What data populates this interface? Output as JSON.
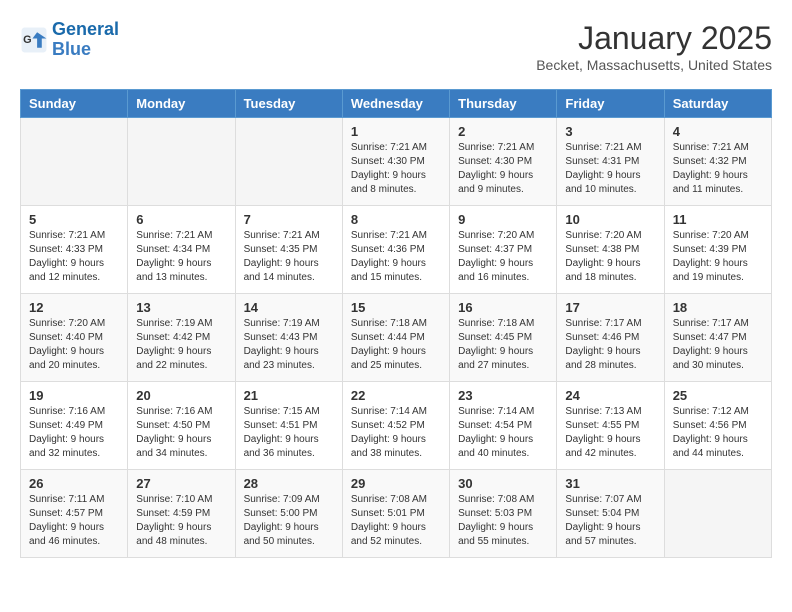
{
  "header": {
    "logo_line1": "General",
    "logo_line2": "Blue",
    "month": "January 2025",
    "location": "Becket, Massachusetts, United States"
  },
  "weekdays": [
    "Sunday",
    "Monday",
    "Tuesday",
    "Wednesday",
    "Thursday",
    "Friday",
    "Saturday"
  ],
  "rows": [
    [
      {
        "day": "",
        "info": ""
      },
      {
        "day": "",
        "info": ""
      },
      {
        "day": "",
        "info": ""
      },
      {
        "day": "1",
        "info": "Sunrise: 7:21 AM\nSunset: 4:30 PM\nDaylight: 9 hours and 8 minutes."
      },
      {
        "day": "2",
        "info": "Sunrise: 7:21 AM\nSunset: 4:30 PM\nDaylight: 9 hours and 9 minutes."
      },
      {
        "day": "3",
        "info": "Sunrise: 7:21 AM\nSunset: 4:31 PM\nDaylight: 9 hours and 10 minutes."
      },
      {
        "day": "4",
        "info": "Sunrise: 7:21 AM\nSunset: 4:32 PM\nDaylight: 9 hours and 11 minutes."
      }
    ],
    [
      {
        "day": "5",
        "info": "Sunrise: 7:21 AM\nSunset: 4:33 PM\nDaylight: 9 hours and 12 minutes."
      },
      {
        "day": "6",
        "info": "Sunrise: 7:21 AM\nSunset: 4:34 PM\nDaylight: 9 hours and 13 minutes."
      },
      {
        "day": "7",
        "info": "Sunrise: 7:21 AM\nSunset: 4:35 PM\nDaylight: 9 hours and 14 minutes."
      },
      {
        "day": "8",
        "info": "Sunrise: 7:21 AM\nSunset: 4:36 PM\nDaylight: 9 hours and 15 minutes."
      },
      {
        "day": "9",
        "info": "Sunrise: 7:20 AM\nSunset: 4:37 PM\nDaylight: 9 hours and 16 minutes."
      },
      {
        "day": "10",
        "info": "Sunrise: 7:20 AM\nSunset: 4:38 PM\nDaylight: 9 hours and 18 minutes."
      },
      {
        "day": "11",
        "info": "Sunrise: 7:20 AM\nSunset: 4:39 PM\nDaylight: 9 hours and 19 minutes."
      }
    ],
    [
      {
        "day": "12",
        "info": "Sunrise: 7:20 AM\nSunset: 4:40 PM\nDaylight: 9 hours and 20 minutes."
      },
      {
        "day": "13",
        "info": "Sunrise: 7:19 AM\nSunset: 4:42 PM\nDaylight: 9 hours and 22 minutes."
      },
      {
        "day": "14",
        "info": "Sunrise: 7:19 AM\nSunset: 4:43 PM\nDaylight: 9 hours and 23 minutes."
      },
      {
        "day": "15",
        "info": "Sunrise: 7:18 AM\nSunset: 4:44 PM\nDaylight: 9 hours and 25 minutes."
      },
      {
        "day": "16",
        "info": "Sunrise: 7:18 AM\nSunset: 4:45 PM\nDaylight: 9 hours and 27 minutes."
      },
      {
        "day": "17",
        "info": "Sunrise: 7:17 AM\nSunset: 4:46 PM\nDaylight: 9 hours and 28 minutes."
      },
      {
        "day": "18",
        "info": "Sunrise: 7:17 AM\nSunset: 4:47 PM\nDaylight: 9 hours and 30 minutes."
      }
    ],
    [
      {
        "day": "19",
        "info": "Sunrise: 7:16 AM\nSunset: 4:49 PM\nDaylight: 9 hours and 32 minutes."
      },
      {
        "day": "20",
        "info": "Sunrise: 7:16 AM\nSunset: 4:50 PM\nDaylight: 9 hours and 34 minutes."
      },
      {
        "day": "21",
        "info": "Sunrise: 7:15 AM\nSunset: 4:51 PM\nDaylight: 9 hours and 36 minutes."
      },
      {
        "day": "22",
        "info": "Sunrise: 7:14 AM\nSunset: 4:52 PM\nDaylight: 9 hours and 38 minutes."
      },
      {
        "day": "23",
        "info": "Sunrise: 7:14 AM\nSunset: 4:54 PM\nDaylight: 9 hours and 40 minutes."
      },
      {
        "day": "24",
        "info": "Sunrise: 7:13 AM\nSunset: 4:55 PM\nDaylight: 9 hours and 42 minutes."
      },
      {
        "day": "25",
        "info": "Sunrise: 7:12 AM\nSunset: 4:56 PM\nDaylight: 9 hours and 44 minutes."
      }
    ],
    [
      {
        "day": "26",
        "info": "Sunrise: 7:11 AM\nSunset: 4:57 PM\nDaylight: 9 hours and 46 minutes."
      },
      {
        "day": "27",
        "info": "Sunrise: 7:10 AM\nSunset: 4:59 PM\nDaylight: 9 hours and 48 minutes."
      },
      {
        "day": "28",
        "info": "Sunrise: 7:09 AM\nSunset: 5:00 PM\nDaylight: 9 hours and 50 minutes."
      },
      {
        "day": "29",
        "info": "Sunrise: 7:08 AM\nSunset: 5:01 PM\nDaylight: 9 hours and 52 minutes."
      },
      {
        "day": "30",
        "info": "Sunrise: 7:08 AM\nSunset: 5:03 PM\nDaylight: 9 hours and 55 minutes."
      },
      {
        "day": "31",
        "info": "Sunrise: 7:07 AM\nSunset: 5:04 PM\nDaylight: 9 hours and 57 minutes."
      },
      {
        "day": "",
        "info": ""
      }
    ]
  ]
}
